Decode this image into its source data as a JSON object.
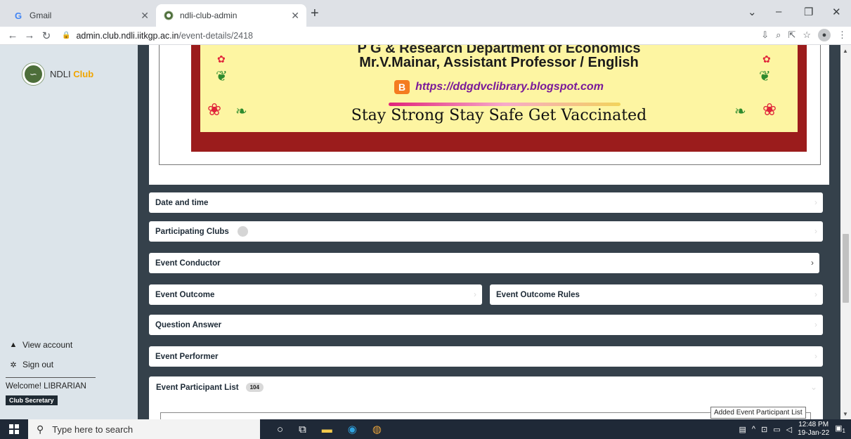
{
  "browser": {
    "tabs": [
      {
        "title": "Gmail",
        "favicon": "gmail-icon"
      },
      {
        "title": "ndli-club-admin",
        "favicon": "ndli-icon"
      }
    ],
    "url_host": "admin.club.ndli.iitkgp.ac.in",
    "url_path": "/event-details/2418"
  },
  "sidebar": {
    "brand_ndli": "NDLI",
    "brand_club": "Club",
    "view_account": "View account",
    "sign_out": "Sign out",
    "welcome": "Welcome! LIBRARIAN",
    "role": "Club Secretary"
  },
  "poster": {
    "line1": "P G & Research Department of Economics",
    "line2": "Mr.V.Mainar, Assistant Professor / English",
    "line3": "https://ddgdvclibrary.blogspot.com",
    "line4": "Stay Strong Stay Safe Get Vaccinated",
    "blog_icon_letter": "B"
  },
  "sections": {
    "date_time": "Date and time",
    "participating_clubs": "Participating Clubs",
    "event_conductor": "Event Conductor",
    "event_outcome": "Event Outcome",
    "event_outcome_rules": "Event Outcome Rules",
    "question_answer": "Question Answer",
    "event_performer": "Event Performer",
    "participant_list": "Event Participant List",
    "participant_count": "104"
  },
  "tooltip": "Added Event Participant List",
  "taskbar": {
    "search_placeholder": "Type here to search",
    "time": "12:48 PM",
    "date": "19-Jan-22",
    "notification_count": "1"
  },
  "colors": {
    "sidebar_bg": "#dce4ea",
    "main_bg": "#35414b",
    "brand_club": "#f0a500",
    "poster_border": "#9b1c1c",
    "poster_bg": "#fdf5a2"
  }
}
